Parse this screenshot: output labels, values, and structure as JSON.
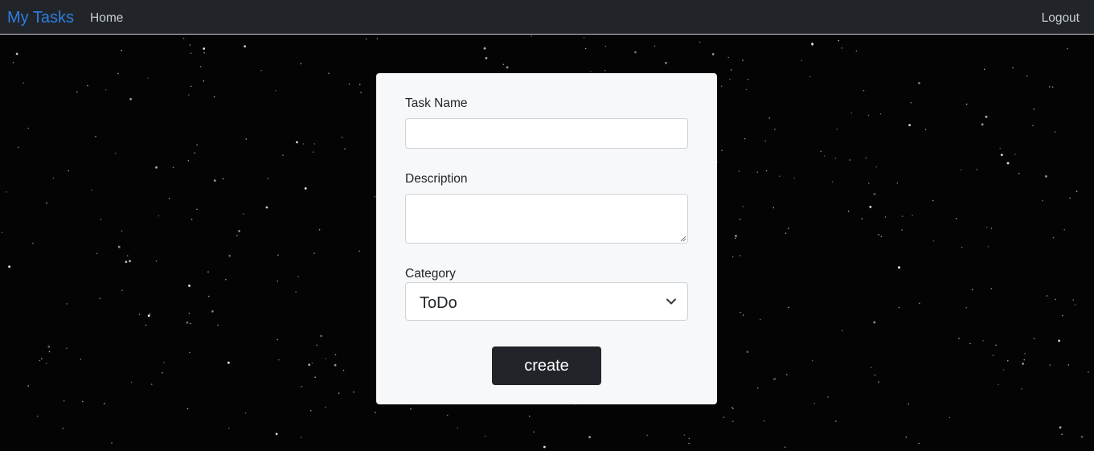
{
  "navbar": {
    "brand": "My Tasks",
    "home_label": "Home",
    "logout_label": "Logout"
  },
  "form": {
    "task_name": {
      "label": "Task Name",
      "value": ""
    },
    "description": {
      "label": "Description",
      "value": ""
    },
    "category": {
      "label": "Category",
      "selected": "ToDo"
    },
    "submit_label": "create"
  },
  "colors": {
    "navbar_bg": "#212529",
    "brand": "#2f7de0",
    "card_bg": "#f7f8f9",
    "button_bg": "#212529"
  },
  "icons": {
    "select_arrow": "chevron-down-icon"
  }
}
